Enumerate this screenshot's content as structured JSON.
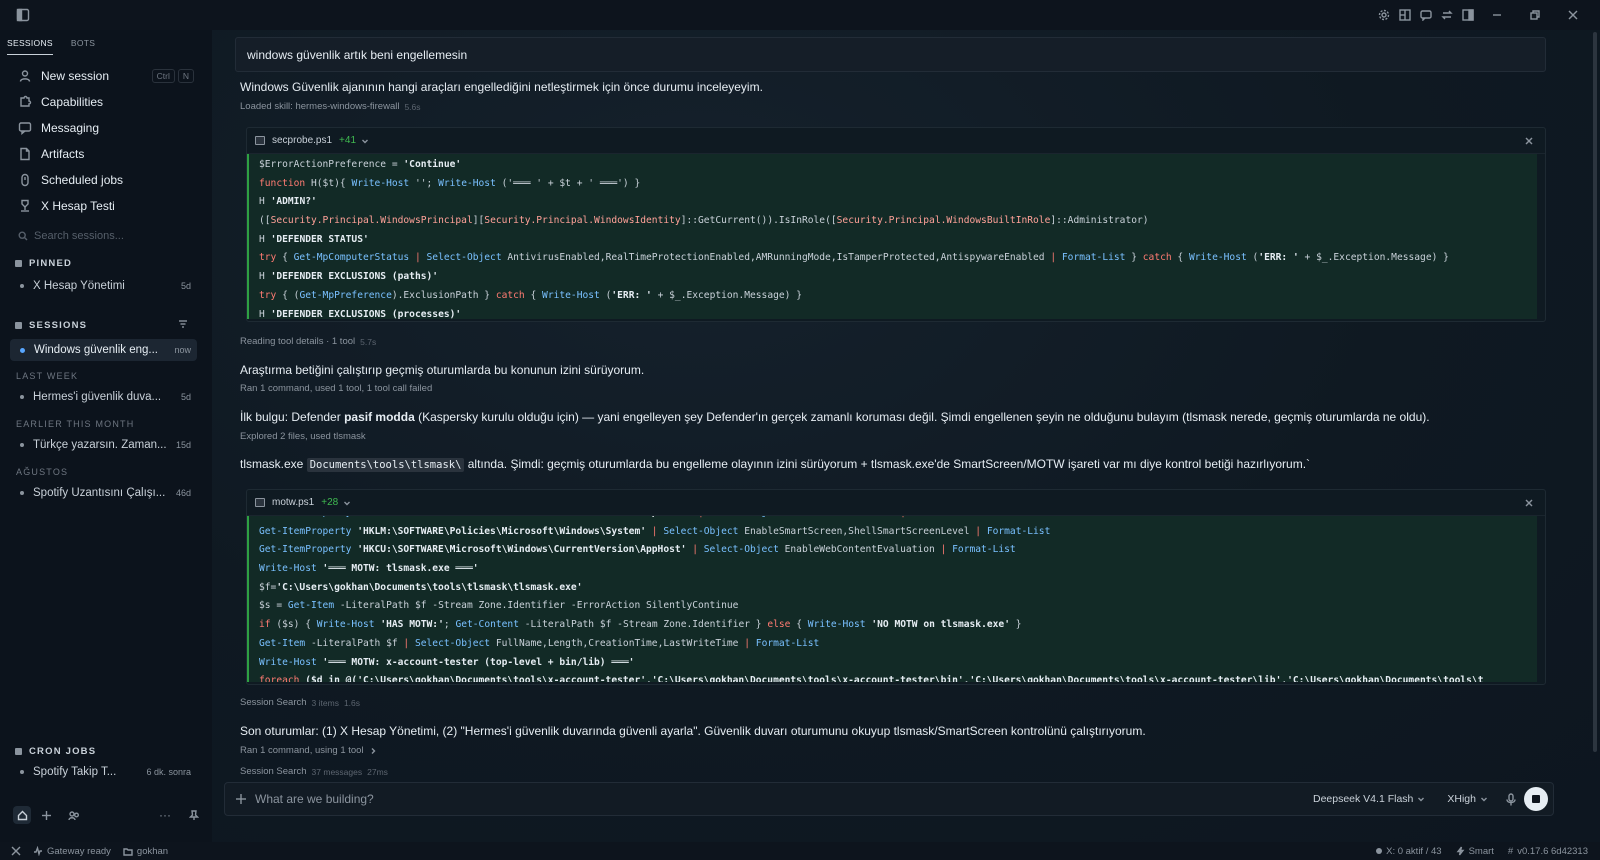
{
  "sidebar": {
    "tabs": [
      "SESSIONS",
      "BOTS"
    ],
    "nav": [
      {
        "label": "New session",
        "icon": "person-icon",
        "shortcut": [
          "Ctrl",
          "N"
        ]
      },
      {
        "label": "Capabilities",
        "icon": "puzzle-icon"
      },
      {
        "label": "Messaging",
        "icon": "chat-icon"
      },
      {
        "label": "Artifacts",
        "icon": "file-icon"
      },
      {
        "label": "Scheduled jobs",
        "icon": "clock-icon"
      },
      {
        "label": "X Hesap Testi",
        "icon": "user-icon"
      }
    ],
    "search_placeholder": "Search sessions...",
    "pinned_title": "PINNED",
    "pinned": [
      {
        "title": "X Hesap Yönetimi",
        "age": "5d"
      }
    ],
    "sessions_title": "SESSIONS",
    "current": [
      {
        "title": "Windows güvenlik eng...",
        "age": "now"
      }
    ],
    "last_week_title": "LAST WEEK",
    "last_week": [
      {
        "title": "Hermes'i güvenlik duva...",
        "age": "5d"
      }
    ],
    "earlier_title": "EARLIER THIS MONTH",
    "earlier": [
      {
        "title": "Türkçe yazarsın. Zaman...",
        "age": "15d"
      }
    ],
    "august_title": "AĞUSTOS",
    "august": [
      {
        "title": "Spotify Uzantısını Çalışı...",
        "age": "46d"
      }
    ],
    "cron_title": "CRON JOBS",
    "cron": [
      {
        "title": "Spotify Takip T...",
        "age": "6 dk. sonra"
      }
    ]
  },
  "statusbar": {
    "gateway": "Gateway ready",
    "user": "gokhan",
    "x_status": "X: 0 aktif / 43",
    "mode": "Smart",
    "version": "v0.17.6 6d42313"
  },
  "chat": {
    "user_message": "windows güvenlik artık beni engellemesin",
    "msg1": "Windows Güvenlik ajanının hangi araçları engellediğini netleştirmek için önce durumu inceleyeyim.",
    "meta1": {
      "text": "Loaded skill: hermes-windows-firewall",
      "time": "5.6s"
    },
    "card1": {
      "filename": "secprobe.ps1",
      "diff": "+41",
      "lines": [
        [
          [
            "$ErrorActionPreference",
            ""
          ],
          [
            " = ",
            ""
          ],
          [
            "'Continue'",
            "s"
          ]
        ],
        [
          [
            "function",
            "k"
          ],
          [
            " H($t){ ",
            ""
          ],
          [
            "Write-Host",
            "f"
          ],
          [
            " ''; ",
            ""
          ],
          [
            "Write-Host",
            "f"
          ],
          [
            " ('═══ ' + $t + ' ═══') }",
            ""
          ]
        ],
        [
          [
            "H ",
            ""
          ],
          [
            "'ADMIN?'",
            "s"
          ]
        ],
        [
          [
            "([",
            ""
          ],
          [
            "Security.Principal.WindowsPrincipal",
            "tp"
          ],
          [
            "][",
            ""
          ],
          [
            "Security.Principal.WindowsIdentity",
            "tp"
          ],
          [
            "]::GetCurrent()).IsInRole([",
            ""
          ],
          [
            "Security.Principal.WindowsBuiltInRole",
            "tp"
          ],
          [
            "]::Administrator)",
            ""
          ]
        ],
        [
          [
            "H ",
            ""
          ],
          [
            "'DEFENDER STATUS'",
            "s"
          ]
        ],
        [
          [
            "try",
            "k"
          ],
          [
            " { ",
            ""
          ],
          [
            "Get-MpComputerStatus",
            "f"
          ],
          [
            " | ",
            "k"
          ],
          [
            "Select-Object",
            "f"
          ],
          [
            " AntivirusEnabled,RealTimeProtectionEnabled,AMRunningMode,IsTamperProtected,AntispywareEnabled ",
            ""
          ],
          [
            "|",
            "k"
          ],
          [
            " ",
            ""
          ],
          [
            "Format-List",
            "f"
          ],
          [
            " } ",
            ""
          ],
          [
            "catch",
            "k"
          ],
          [
            " { ",
            ""
          ],
          [
            "Write-Host",
            "f"
          ],
          [
            " (",
            ""
          ],
          [
            "'ERR: '",
            "s"
          ],
          [
            " + $_.Exception.Message) }",
            ""
          ]
        ],
        [
          [
            "H ",
            ""
          ],
          [
            "'DEFENDER EXCLUSIONS (paths)'",
            "s"
          ]
        ],
        [
          [
            "try",
            "k"
          ],
          [
            " { (",
            ""
          ],
          [
            "Get-MpPreference",
            "f"
          ],
          [
            ").ExclusionPath } ",
            ""
          ],
          [
            "catch",
            "k"
          ],
          [
            " { ",
            ""
          ],
          [
            "Write-Host",
            "f"
          ],
          [
            " (",
            ""
          ],
          [
            "'ERR: '",
            "s"
          ],
          [
            " + $_.Exception.Message) }",
            ""
          ]
        ],
        [
          [
            "H ",
            ""
          ],
          [
            "'DEFENDER EXCLUSIONS (processes)'",
            "s"
          ]
        ]
      ]
    },
    "meta2": {
      "text": "Reading tool details · 1 tool",
      "time": "5.7s"
    },
    "msg2": "Araştırma betiğini çalıştırıp geçmiş oturumlarda bu konunun izini sürüyorum.",
    "meta3": {
      "text": "Ran 1 command, used 1 tool, 1 tool call failed"
    },
    "msg3_pre": "İlk bulgu: Defender ",
    "msg3_bold": "pasif modda",
    "msg3_post": " (Kaspersky kurulu olduğu için) — yani engelleyen şey Defender'ın gerçek zamanlı koruması değil. Şimdi engellenen şeyin ne olduğunu bulayım (tlsmask nerede, geçmiş oturumlarda ne oldu).",
    "meta4": {
      "text": "Explored 2 files, used tlsmask"
    },
    "msg4_pre": "tlsmask.exe ",
    "msg4_code": "Documents\\tools\\tlsmask\\",
    "msg4_post": " altında. Şimdi: geçmiş oturumlarda bu engelleme olayının izini sürüyorum + tlsmask.exe'de SmartScreen/MOTW işareti var mı diye kontrol betiği hazırlıyorum.`",
    "card2": {
      "filename": "motw.ps1",
      "diff": "+28",
      "lines": [
        [
          [
            "Get-ItemProperty",
            "f"
          ],
          [
            " 'HKLM:\\SOFTWARE\\Microsoft\\Windows\\CurrentVersion\\Explorer' ",
            "s"
          ],
          [
            "|",
            "k"
          ],
          [
            " ",
            ""
          ],
          [
            "Select-Object",
            "f"
          ],
          [
            " SmartScreenEnabled ",
            ""
          ],
          [
            "|",
            "k"
          ],
          [
            " ",
            ""
          ],
          [
            "Format-List",
            "f"
          ]
        ],
        [
          [
            "Get-ItemProperty",
            "f"
          ],
          [
            " 'HKLM:\\SOFTWARE\\Policies\\Microsoft\\Windows\\System' ",
            "s"
          ],
          [
            "|",
            "k"
          ],
          [
            " ",
            ""
          ],
          [
            "Select-Object",
            "f"
          ],
          [
            " EnableSmartScreen,ShellSmartScreenLevel ",
            ""
          ],
          [
            "|",
            "k"
          ],
          [
            " ",
            ""
          ],
          [
            "Format-List",
            "f"
          ]
        ],
        [
          [
            "Get-ItemProperty",
            "f"
          ],
          [
            " 'HKCU:\\SOFTWARE\\Microsoft\\Windows\\CurrentVersion\\AppHost' ",
            "s"
          ],
          [
            "|",
            "k"
          ],
          [
            " ",
            ""
          ],
          [
            "Select-Object",
            "f"
          ],
          [
            " EnableWebContentEvaluation ",
            ""
          ],
          [
            "|",
            "k"
          ],
          [
            " ",
            ""
          ],
          [
            "Format-List",
            "f"
          ]
        ],
        [
          [
            "Write-Host",
            "f"
          ],
          [
            " ",
            ""
          ],
          [
            "'═══ MOTW: tlsmask.exe ═══'",
            "s"
          ]
        ],
        [
          [
            "$f=",
            ""
          ],
          [
            "'C:\\Users\\gokhan\\Documents\\tools\\tlsmask\\tlsmask.exe'",
            "s"
          ]
        ],
        [
          [
            "$s = ",
            ""
          ],
          [
            "Get-Item",
            "f"
          ],
          [
            " -LiteralPath $f -Stream Zone.Identifier -ErrorAction SilentlyContinue",
            ""
          ]
        ],
        [
          [
            "if",
            "k"
          ],
          [
            " ($s) { ",
            ""
          ],
          [
            "Write-Host",
            "f"
          ],
          [
            " ",
            ""
          ],
          [
            "'HAS MOTW:'",
            "s"
          ],
          [
            "; ",
            ""
          ],
          [
            "Get-Content",
            "f"
          ],
          [
            " -LiteralPath $f -Stream Zone.Identifier } ",
            ""
          ],
          [
            "else",
            "k"
          ],
          [
            " { ",
            ""
          ],
          [
            "Write-Host",
            "f"
          ],
          [
            " ",
            ""
          ],
          [
            "'NO MOTW on tlsmask.exe'",
            "s"
          ],
          [
            " }",
            ""
          ]
        ],
        [
          [
            "Get-Item",
            "f"
          ],
          [
            " -LiteralPath $f ",
            ""
          ],
          [
            "|",
            "k"
          ],
          [
            " ",
            ""
          ],
          [
            "Select-Object",
            "f"
          ],
          [
            " FullName,Length,CreationTime,LastWriteTime ",
            ""
          ],
          [
            "|",
            "k"
          ],
          [
            " ",
            ""
          ],
          [
            "Format-List",
            "f"
          ]
        ],
        [
          [
            "Write-Host",
            "f"
          ],
          [
            " ",
            ""
          ],
          [
            "'═══ MOTW: x-account-tester (top-level + bin/lib) ═══'",
            "s"
          ]
        ],
        [
          [
            "foreach",
            "k"
          ],
          [
            " ($d in @('C:\\Users\\gokhan\\Documents\\tools\\x-account-tester','C:\\Users\\gokhan\\Documents\\tools\\x-account-tester\\bin','C:\\Users\\gokhan\\Documents\\tools\\x-account-tester\\lib','C:\\Users\\gokhan\\Documents\\tools\\t",
            "s"
          ]
        ]
      ]
    },
    "meta5": {
      "text": "Session Search",
      "extra": "3 items",
      "time": "1.6s"
    },
    "msg5": "Son oturumlar: (1) X Hesap Yönetimi, (2) \"Hermes'i güvenlik duvarında güvenli ayarla\". Güvenlik duvarı oturumunu okuyup tlsmask/SmartScreen kontrolünü çalıştırıyorum.",
    "meta6": {
      "text": "Ran 1 command, using 1 tool"
    },
    "meta7": {
      "text": "Session Search",
      "extra": "37 messages",
      "time": "27ms"
    }
  },
  "composer": {
    "placeholder": "What are we building?",
    "model": "Deepseek V4.1 Flash",
    "effort": "XHigh"
  },
  "colors": {
    "accent": "#58a6ff",
    "diff_add": "#3fb950",
    "code_bg": "#122a26"
  }
}
